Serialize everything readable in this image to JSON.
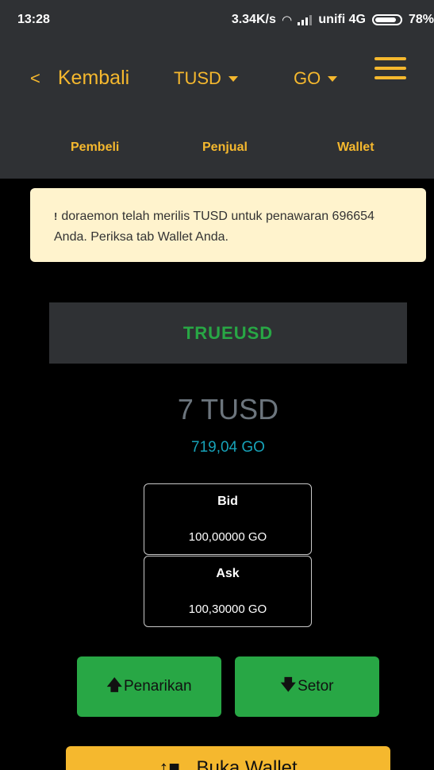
{
  "status_bar": {
    "time": "13:28",
    "network_speed": "3.34K/s",
    "wifi_icon": "wifi-icon",
    "signal_icon": "signal-icon",
    "carrier": "unifi 4G",
    "battery_icon": "battery-icon",
    "battery": "78%"
  },
  "header": {
    "back_label": "Kembali",
    "back_icon": "chevron-left-icon",
    "currency_dropdown": "TUSD",
    "market_dropdown": "GO",
    "menu_icon": "hamburger-menu-icon",
    "tabs": [
      {
        "label": "Pembeli"
      },
      {
        "label": "Penjual"
      },
      {
        "label": "Wallet"
      }
    ]
  },
  "alert": {
    "icon": "exclamation-icon",
    "icon_glyph": "!",
    "message": "doraemon telah merilis TUSD untuk penawaran 696654 Anda. Periksa tab Wallet Anda."
  },
  "asset": {
    "name": "TRUEUSD",
    "amount": "7 TUSD",
    "value": "719,04 GO"
  },
  "quotes": [
    {
      "label": "Bid",
      "value": "100,00000 GO"
    },
    {
      "label": "Ask",
      "value": "100,30000 GO"
    }
  ],
  "actions": {
    "withdraw_label": "Penarikan",
    "withdraw_icon": "arrow-up-icon",
    "deposit_label": "Setor",
    "deposit_icon": "arrow-down-icon",
    "wallet_label": "Buka Wallet",
    "wallet_icon": "wallet-icon"
  },
  "colors": {
    "accent": "#f5b82e",
    "header_bg": "#2f3134",
    "success": "#28a745",
    "info": "#17a2b8",
    "alert_bg": "#fff3cd"
  }
}
